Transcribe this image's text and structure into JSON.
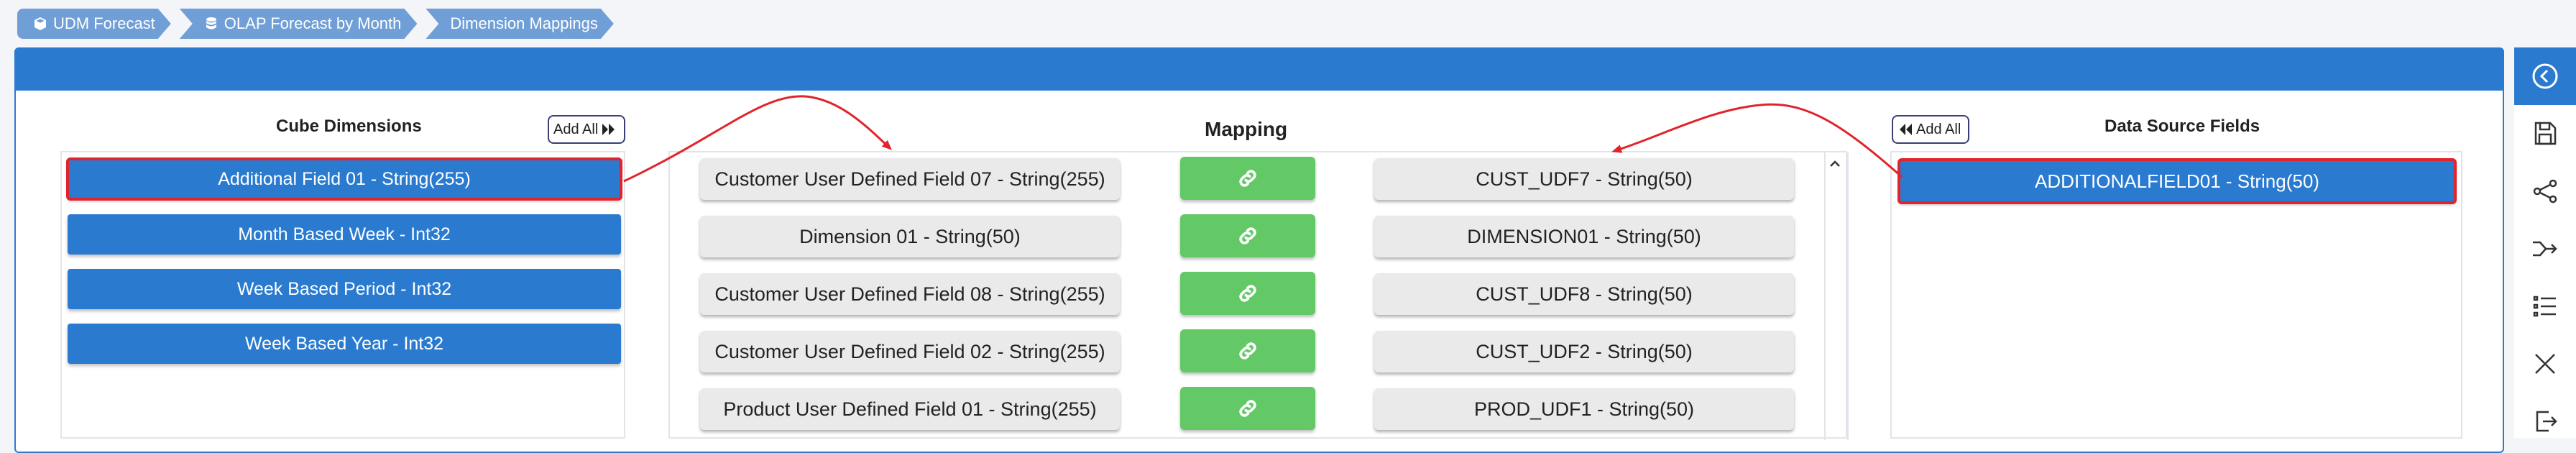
{
  "breadcrumb": [
    {
      "label": "UDM Forecast",
      "icon": "cube-icon"
    },
    {
      "label": "OLAP Forecast by Month",
      "icon": "database-icon"
    },
    {
      "label": "Dimension Mappings",
      "icon": ""
    }
  ],
  "cube": {
    "title": "Cube Dimensions",
    "add_all_label": "Add All",
    "items": [
      "Additional Field 01 - String(255)",
      "Month Based Week - Int32",
      "Week Based Period - Int32",
      "Week Based Year - Int32"
    ]
  },
  "mapping": {
    "title": "Mapping",
    "rows": [
      {
        "cube": "Customer User Defined Field 07 - String(255)",
        "source": "CUST_UDF7 - String(50)"
      },
      {
        "cube": "Dimension 01 - String(50)",
        "source": "DIMENSION01 - String(50)"
      },
      {
        "cube": "Customer User Defined Field 08 - String(255)",
        "source": "CUST_UDF8 - String(50)"
      },
      {
        "cube": "Customer User Defined Field 02 - String(255)",
        "source": "CUST_UDF2 - String(50)"
      },
      {
        "cube": "Product User Defined Field 01 - String(255)",
        "source": "PROD_UDF1 - String(50)"
      }
    ]
  },
  "source": {
    "title": "Data Source Fields",
    "add_all_label": "Add All",
    "items": [
      "ADDITIONALFIELD01 - String(50)"
    ]
  },
  "toolbar": [
    "back-icon",
    "save-icon",
    "share-icon",
    "merge-icon",
    "list-icon",
    "close-icon",
    "exit-icon"
  ],
  "colors": {
    "primary": "#2a7bd0",
    "link_green": "#63c866",
    "highlight_red": "#e0242c",
    "breadcrumb": "#6f9fd6"
  }
}
